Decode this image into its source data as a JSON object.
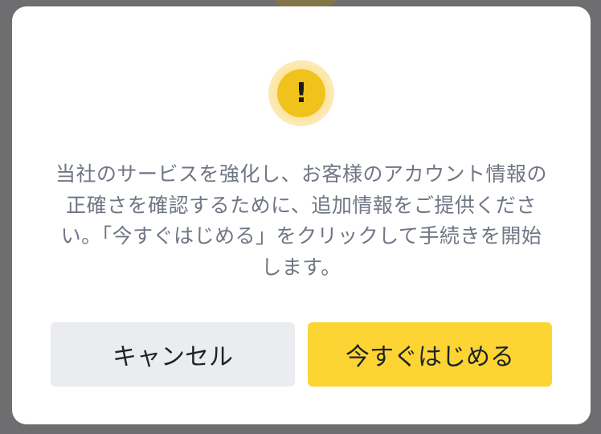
{
  "dialog": {
    "icon": "exclamation-warning-icon",
    "icon_glyph": "!",
    "message": "当社のサービスを強化し、お客様のアカウント情報の正確さを確認するために、追加情報をご提供ください。「今すぐはじめる」をクリックして手続きを開始します。",
    "cancel_label": "キャンセル",
    "start_label": "今すぐはじめる"
  },
  "colors": {
    "accent_yellow": "#fcd535",
    "icon_yellow": "#f1c21b",
    "cancel_bg": "#eaecef",
    "text_muted": "#6f7684",
    "text_dark": "#1e2328"
  }
}
